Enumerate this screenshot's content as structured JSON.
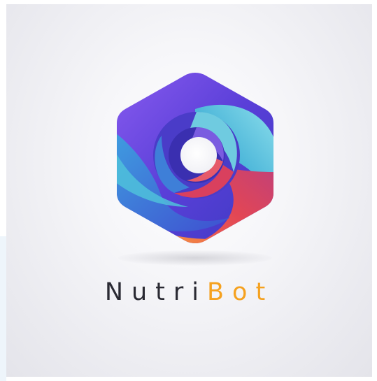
{
  "brand": {
    "name_part_1": "Nutri",
    "name_part_2": "Bot",
    "colors": {
      "text_dark": "#2a2a33",
      "accent_orange": "#f5a11f",
      "purple": "#6a3fd0",
      "blue": "#3f6fe0",
      "teal": "#4fc1da",
      "red": "#e0405a",
      "orange": "#f39a3a"
    }
  },
  "logo": {
    "icon": "hexagon-swirl-icon"
  }
}
